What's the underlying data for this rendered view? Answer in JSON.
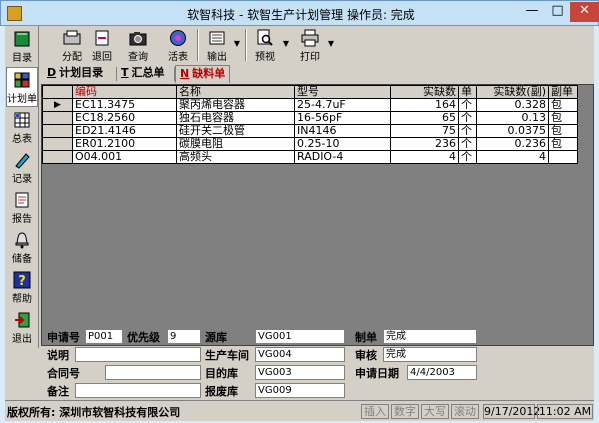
{
  "window": {
    "title": "软智科技 - 软智生产计划管理 操作员: 完成"
  },
  "leftbar": [
    {
      "label": "目录",
      "icon": "book-icon"
    },
    {
      "label": "计划单",
      "icon": "puzzle-icon"
    },
    {
      "label": "总表",
      "icon": "grid-icon"
    },
    {
      "label": "记录",
      "icon": "pencil-icon"
    },
    {
      "label": "报告",
      "icon": "report-icon"
    },
    {
      "label": "储备",
      "icon": "bell-icon"
    },
    {
      "label": "帮助",
      "icon": "help-icon"
    },
    {
      "label": "退出",
      "icon": "exit-icon"
    }
  ],
  "toolbar": {
    "allocate": "分配",
    "return": "退回",
    "query": "查询",
    "activate": "活表",
    "export": "输出",
    "preview": "预视",
    "print": "打印"
  },
  "tabs": [
    {
      "key": "D",
      "label": "计划目录"
    },
    {
      "key": "T",
      "label": "汇总单"
    },
    {
      "key": "N",
      "label": "缺料单"
    }
  ],
  "grid": {
    "columns": [
      "",
      "编码",
      "名称",
      "型号",
      "实缺数",
      "单",
      "实缺数(副)",
      "副单"
    ],
    "rows": [
      [
        "EC11.3475",
        "聚丙烯电容器",
        "25-4.7uF",
        "164",
        "个",
        "0.328",
        "包"
      ],
      [
        "EC18.2560",
        "独石电容器",
        "16-56pF",
        "65",
        "个",
        "0.13",
        "包"
      ],
      [
        "ED21.4146",
        "硅开关二极管",
        "IN4146",
        "75",
        "个",
        "0.0375",
        "包"
      ],
      [
        "ER01.2100",
        "碳膜电阻",
        "0.25-10",
        "236",
        "个",
        "0.236",
        "包"
      ],
      [
        "O04.001",
        "高频头",
        "RADIO-4",
        "4",
        "个",
        "4",
        ""
      ]
    ]
  },
  "form": {
    "req_no_label": "申请号",
    "req_no": "P001",
    "priority_label": "优先级",
    "priority": "9",
    "source_label": "源库",
    "source": "VG001",
    "maker_label": "制单",
    "maker": "完成",
    "note_label": "说明",
    "note": "",
    "workshop_label": "生产车间",
    "workshop": "VG004",
    "auditor_label": "审核",
    "auditor": "完成",
    "contract_label": "合同号",
    "contract": "",
    "dest_label": "目的库",
    "dest": "VG003",
    "date_label": "申请日期",
    "date": "4/4/2003",
    "remark_label": "备注",
    "remark": "",
    "scrap_label": "报废库",
    "scrap": "VG009"
  },
  "status": {
    "copyright": "版权所有: 深圳市软智科技有限公司",
    "insert": "插入",
    "num": "数字",
    "caps": "大写",
    "scroll": "滚动",
    "date": "9/17/2012",
    "time": "11:02 AM"
  }
}
